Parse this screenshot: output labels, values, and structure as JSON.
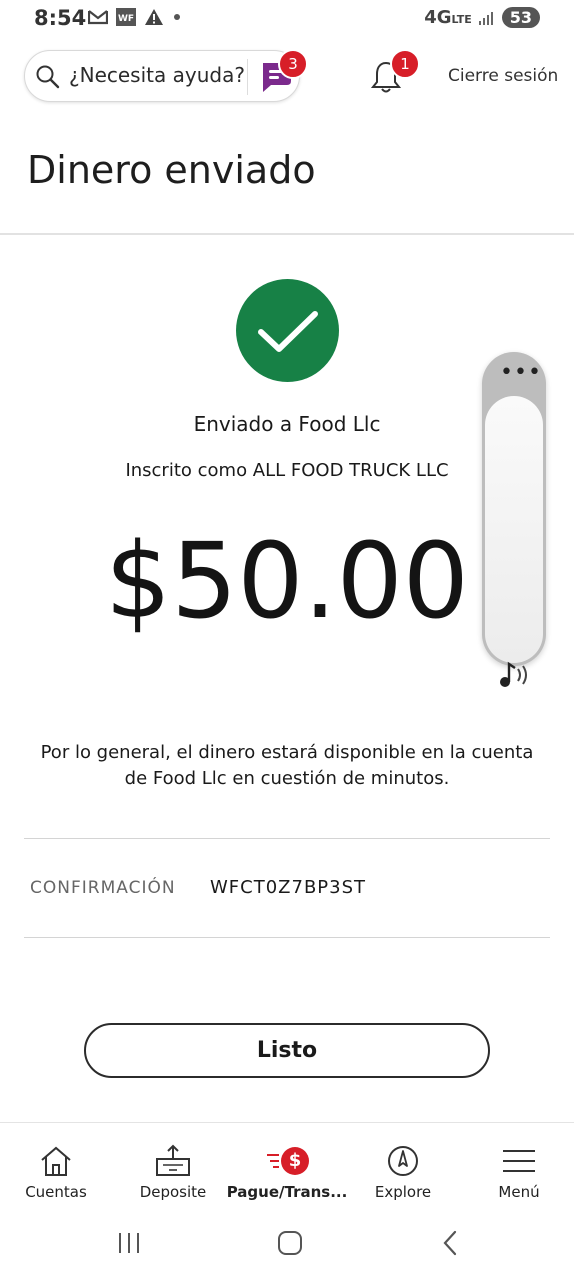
{
  "status_bar": {
    "time": "8:54",
    "network": "4G",
    "network_sub": "LTE",
    "battery": "53",
    "icons": [
      "gmail-icon",
      "wf-app-icon",
      "warning-icon",
      "dot-icon",
      "signal-icon"
    ]
  },
  "header": {
    "search_placeholder": "¿Necesita ayuda?",
    "chat_badge": "3",
    "notification_badge": "1",
    "logout_label": "Cierre sesión"
  },
  "page": {
    "title": "Dinero enviado"
  },
  "confirmation_panel": {
    "sent_to": "Enviado a Food Llc",
    "enrolled_as": "Inscrito como ALL FOOD TRUCK LLC",
    "amount": "$50.00",
    "info_text": "Por lo general, el dinero estará disponible en la cuenta de Food Llc en cuestión de minutos.",
    "confirmation_label": "CONFIRMACIÓN",
    "confirmation_number": "WFCT0Z7BP3ST",
    "done_label": "Listo"
  },
  "bottom_nav": {
    "items": [
      {
        "label": "Cuentas",
        "icon": "home-icon"
      },
      {
        "label": "Deposite",
        "icon": "deposit-icon"
      },
      {
        "label": "Pague/Trans...",
        "icon": "pay-transfer-icon",
        "badge": "$",
        "active": true
      },
      {
        "label": "Explore",
        "icon": "compass-icon"
      },
      {
        "label": "Menú",
        "icon": "menu-icon"
      }
    ]
  },
  "colors": {
    "success": "#178146",
    "brand_red": "#d71e28",
    "chat_purple": "#7b2a8c"
  }
}
